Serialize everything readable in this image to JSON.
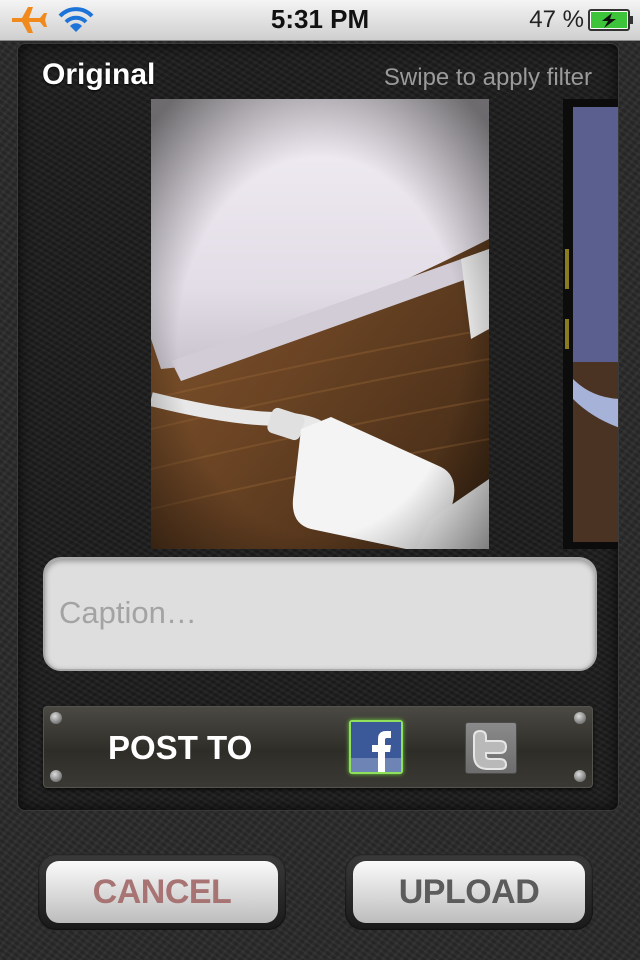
{
  "status_bar": {
    "time": "5:31 PM",
    "battery_percent": "47 %",
    "icons": [
      "airplane-icon",
      "wifi-icon",
      "battery-charging-icon"
    ]
  },
  "editor": {
    "filter_name": "Original",
    "swipe_hint": "Swipe to apply filter"
  },
  "caption": {
    "placeholder": "Caption…",
    "value": ""
  },
  "post_to": {
    "label": "POST TO",
    "targets": [
      {
        "name": "facebook",
        "selected": true
      },
      {
        "name": "twitter",
        "selected": false
      }
    ]
  },
  "actions": {
    "cancel_label": "CANCEL",
    "upload_label": "UPLOAD"
  },
  "colors": {
    "facebook": "#3b5998",
    "selected_glow": "#8fe05a",
    "cancel_text": "#a87373",
    "upload_text": "#5c5c5c"
  }
}
